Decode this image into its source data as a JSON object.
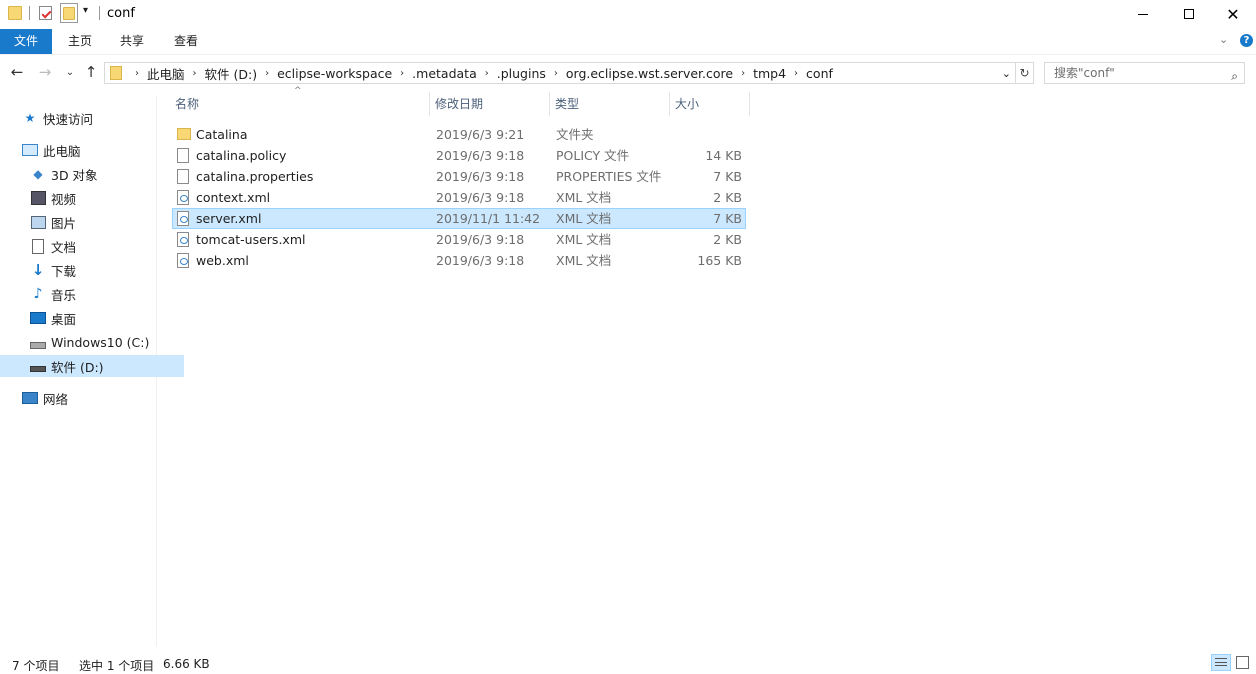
{
  "window": {
    "title": "conf"
  },
  "ribbon": {
    "tabs": [
      "文件",
      "主页",
      "共享",
      "查看"
    ]
  },
  "address": {
    "crumbs": [
      "此电脑",
      "软件 (D:)",
      "eclipse-workspace",
      ".metadata",
      ".plugins",
      "org.eclipse.wst.server.core",
      "tmp4",
      "conf"
    ],
    "search_placeholder": "搜索\"conf\""
  },
  "sidebar": {
    "items": [
      {
        "label": "快速访问",
        "icon": "star-icon"
      },
      {
        "label": "此电脑",
        "icon": "computer-icon"
      },
      {
        "label": "3D 对象",
        "icon": "cube-icon"
      },
      {
        "label": "视频",
        "icon": "video-icon"
      },
      {
        "label": "图片",
        "icon": "picture-icon"
      },
      {
        "label": "文档",
        "icon": "document-icon"
      },
      {
        "label": "下载",
        "icon": "download-icon"
      },
      {
        "label": "音乐",
        "icon": "music-icon"
      },
      {
        "label": "桌面",
        "icon": "desktop-icon"
      },
      {
        "label": "Windows10 (C:)",
        "icon": "drive-icon"
      },
      {
        "label": "软件 (D:)",
        "icon": "drive-icon"
      },
      {
        "label": "网络",
        "icon": "network-icon"
      }
    ]
  },
  "columns": {
    "name": "名称",
    "modified": "修改日期",
    "type": "类型",
    "size": "大小"
  },
  "files": [
    {
      "name": "Catalina",
      "modified": "2019/6/3 9:21",
      "type": "文件夹",
      "size": "",
      "icon": "folder-icon"
    },
    {
      "name": "catalina.policy",
      "modified": "2019/6/3 9:18",
      "type": "POLICY 文件",
      "size": "14 KB",
      "icon": "file-icon"
    },
    {
      "name": "catalina.properties",
      "modified": "2019/6/3 9:18",
      "type": "PROPERTIES 文件",
      "size": "7 KB",
      "icon": "file-icon"
    },
    {
      "name": "context.xml",
      "modified": "2019/6/3 9:18",
      "type": "XML 文档",
      "size": "2 KB",
      "icon": "xml-file-icon"
    },
    {
      "name": "server.xml",
      "modified": "2019/11/1 11:42",
      "type": "XML 文档",
      "size": "7 KB",
      "icon": "xml-file-icon"
    },
    {
      "name": "tomcat-users.xml",
      "modified": "2019/6/3 9:18",
      "type": "XML 文档",
      "size": "2 KB",
      "icon": "xml-file-icon"
    },
    {
      "name": "web.xml",
      "modified": "2019/6/3 9:18",
      "type": "XML 文档",
      "size": "165 KB",
      "icon": "xml-file-icon"
    }
  ],
  "status": {
    "count": "7 个项目",
    "selected": "选中 1 个项目",
    "selected_size": "6.66 KB"
  },
  "colors": {
    "accent": "#1979ca",
    "selection": "#cce8ff"
  }
}
